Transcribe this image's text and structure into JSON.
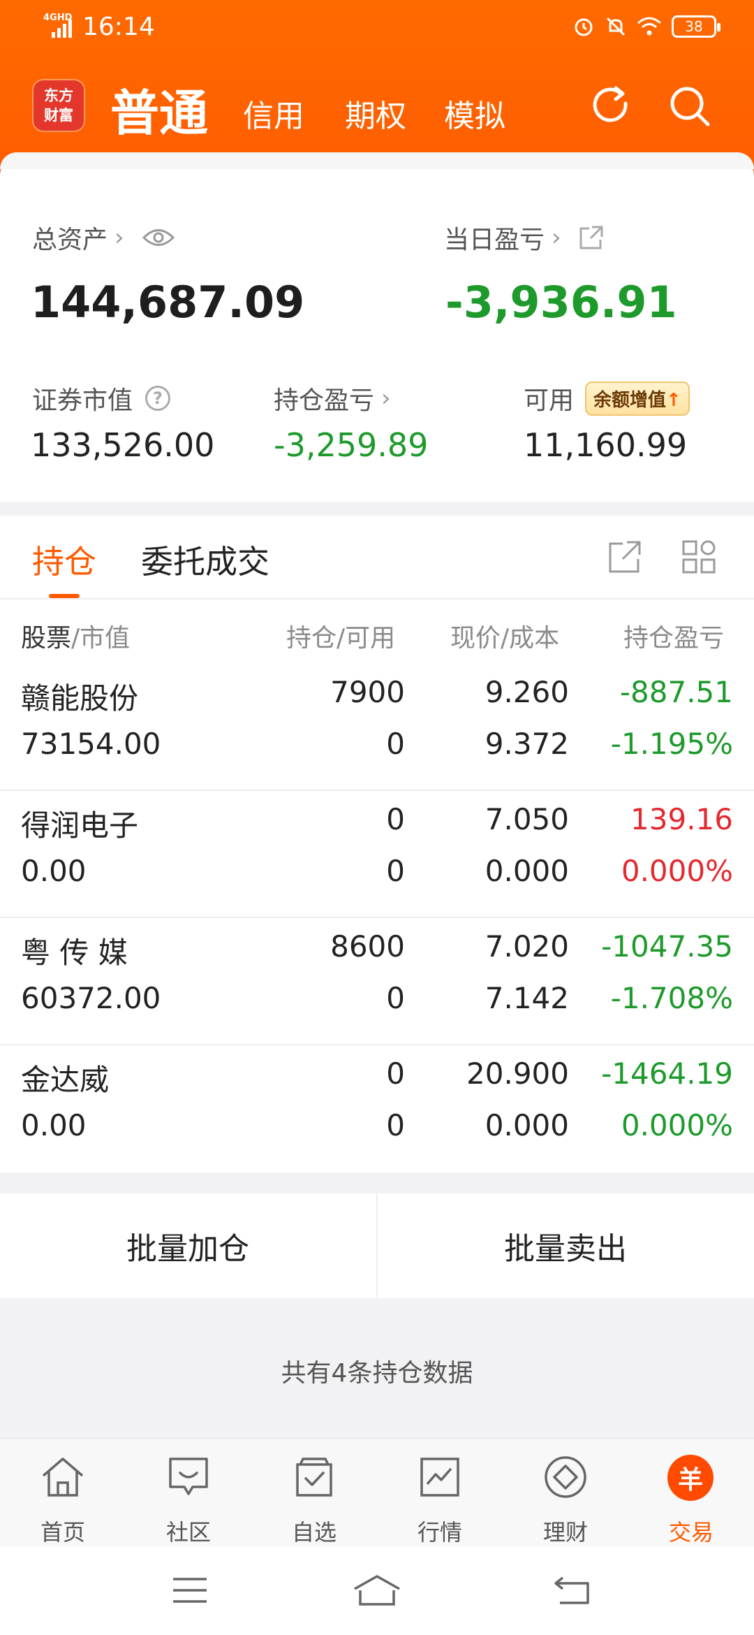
{
  "status_bar": {
    "network": "4GHD",
    "time": "16:14",
    "battery": "38"
  },
  "header": {
    "logo_line1": "东方",
    "logo_line2": "财富",
    "tabs": [
      {
        "label": "普通"
      },
      {
        "label": "信用"
      },
      {
        "label": "期权"
      },
      {
        "label": "模拟"
      }
    ]
  },
  "summary": {
    "total_assets_label": "总资产",
    "total_assets_value": "144,687.09",
    "daily_pnl_label": "当日盈亏",
    "daily_pnl_value": "-3,936.91",
    "market_value_label": "证券市值",
    "market_value": "133,526.00",
    "position_pnl_label": "持仓盈亏",
    "position_pnl_value": "-3,259.89",
    "available_label": "可用",
    "available_badge": "余额增值",
    "available_value": "11,160.99"
  },
  "positions": {
    "tabs": [
      "持仓",
      "委托成交"
    ],
    "columns": {
      "c1a": "股票",
      "c1b": "/市值",
      "c2": "持仓/可用",
      "c3": "现价/成本",
      "c4": "持仓盈亏"
    },
    "rows": [
      {
        "name": "赣能股份",
        "market_value": "73154.00",
        "hold": "7900",
        "avail": "0",
        "price": "9.260",
        "cost": "9.372",
        "pnl": "-887.51",
        "pnl_pct": "-1.195%",
        "pnl_color": "green",
        "pct_color": "green"
      },
      {
        "name": "得润电子",
        "market_value": "0.00",
        "hold": "0",
        "avail": "0",
        "price": "7.050",
        "cost": "0.000",
        "pnl": "139.16",
        "pnl_pct": "0.000%",
        "pnl_color": "red",
        "pct_color": "red"
      },
      {
        "name": "粤 传 媒",
        "market_value": "60372.00",
        "hold": "8600",
        "avail": "0",
        "price": "7.020",
        "cost": "7.142",
        "pnl": "-1047.35",
        "pnl_pct": "-1.708%",
        "pnl_color": "green",
        "pct_color": "green"
      },
      {
        "name": "金达威",
        "market_value": "0.00",
        "hold": "0",
        "avail": "0",
        "price": "20.900",
        "cost": "0.000",
        "pnl": "-1464.19",
        "pnl_pct": "0.000%",
        "pnl_color": "green",
        "pct_color": "green"
      }
    ]
  },
  "batch": {
    "add_label": "批量加仓",
    "sell_label": "批量卖出"
  },
  "total_note": "共有4条持仓数据",
  "bottom_nav": [
    {
      "label": "首页",
      "icon": "home-icon"
    },
    {
      "label": "社区",
      "icon": "community-icon"
    },
    {
      "label": "自选",
      "icon": "watchlist-icon"
    },
    {
      "label": "行情",
      "icon": "market-icon"
    },
    {
      "label": "理财",
      "icon": "wealth-icon"
    },
    {
      "label": "交易",
      "icon": "trade-icon",
      "glyph": "羊"
    }
  ],
  "colors": {
    "accent": "#ff5a00",
    "down": "#1d9a2b",
    "up": "#e3292f"
  }
}
